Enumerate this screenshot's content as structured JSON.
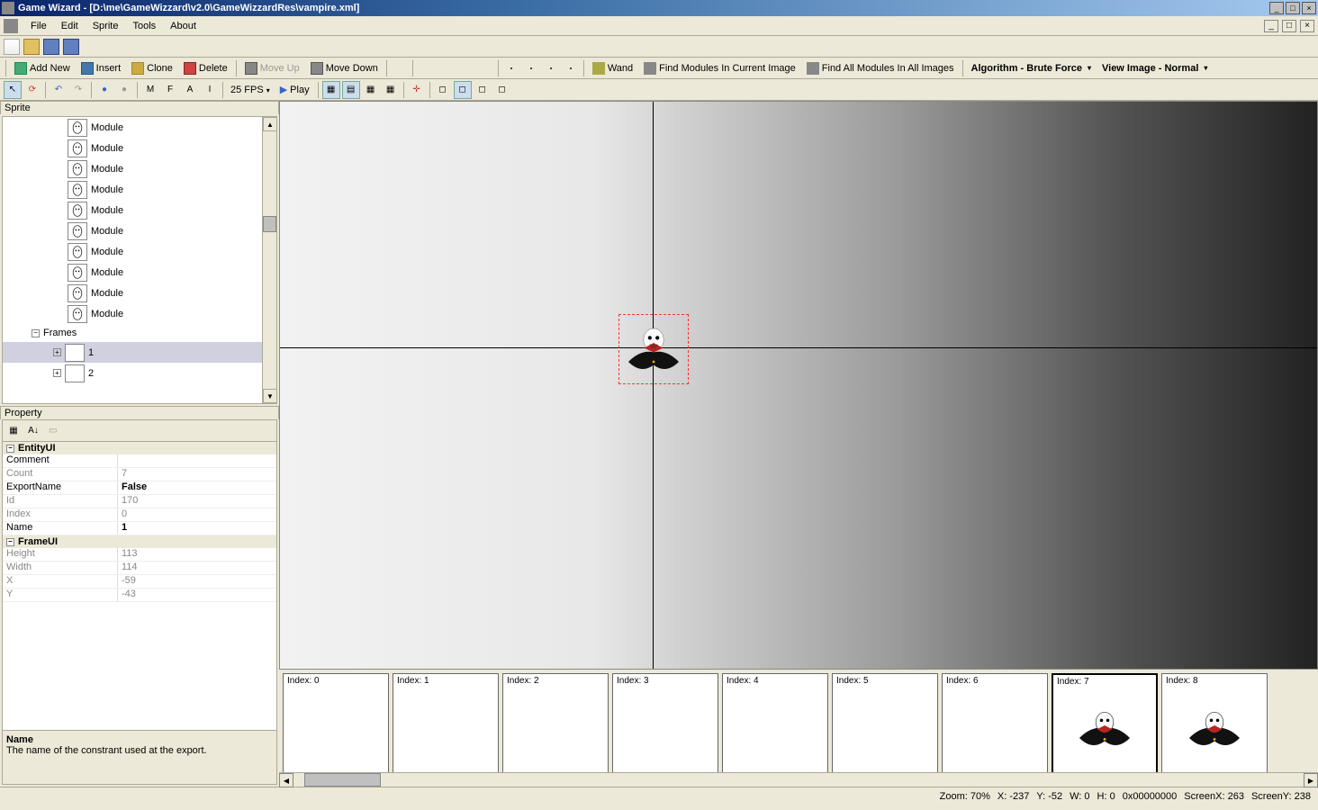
{
  "title": "Game Wizard - [D:\\me\\GameWizzard\\v2.0\\GameWizzardRes\\vampire.xml]",
  "menu": {
    "file": "File",
    "edit": "Edit",
    "sprite": "Sprite",
    "tools": "Tools",
    "about": "About"
  },
  "toolbar": {
    "addnew": "Add New",
    "insert": "Insert",
    "clone": "Clone",
    "delete": "Delete",
    "moveup": "Move Up",
    "movedown": "Move Down",
    "wand": "Wand",
    "findmod": "Find Modules In Current Image",
    "findall": "Find All Modules In All Images",
    "algorithm": "Algorithm - Brute Force",
    "viewimage": "View Image - Normal"
  },
  "toolbar2": {
    "fps": "25 FPS",
    "play": "Play",
    "m": "M",
    "f": "F",
    "a": "A",
    "i": "I"
  },
  "tree": {
    "panel": "Sprite",
    "modules": [
      "Module",
      "Module",
      "Module",
      "Module",
      "Module",
      "Module",
      "Module",
      "Module",
      "Module",
      "Module"
    ],
    "frames_label": "Frames",
    "frames": [
      "1",
      "2"
    ]
  },
  "property": {
    "panel": "Property",
    "cat1": "EntityUI",
    "rows1": [
      {
        "n": "Comment",
        "v": ""
      },
      {
        "n": "Count",
        "v": "7"
      },
      {
        "n": "ExportName",
        "v": "False"
      },
      {
        "n": "Id",
        "v": "170"
      },
      {
        "n": "Index",
        "v": "0"
      },
      {
        "n": "Name",
        "v": "1"
      }
    ],
    "cat2": "FrameUI",
    "rows2": [
      {
        "n": "Height",
        "v": "113"
      },
      {
        "n": "Width",
        "v": "114"
      },
      {
        "n": "X",
        "v": "-59"
      },
      {
        "n": "Y",
        "v": "-43"
      }
    ],
    "desc_name": "Name",
    "desc_text": "The name of the constrant used at the export."
  },
  "strip": {
    "cells": [
      "Index: 0",
      "Index: 1",
      "Index: 2",
      "Index: 3",
      "Index: 4",
      "Index: 5",
      "Index: 6",
      "Index: 7",
      "Index: 8"
    ]
  },
  "status": {
    "zoom": "Zoom: 70%",
    "x": "X: -237",
    "y": "Y: -52",
    "w": "W: 0",
    "h": "H: 0",
    "color": "0x00000000",
    "sx": "ScreenX: 263",
    "sy": "ScreenY: 238"
  }
}
